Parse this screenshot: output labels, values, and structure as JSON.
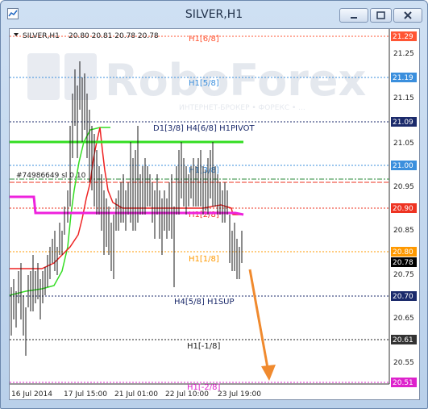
{
  "window": {
    "title": "SILVER,H1",
    "buttons": [
      "minimize",
      "maximize",
      "close"
    ]
  },
  "chart": {
    "symbol_label": "SILVER,H1",
    "ohlc": "20.80 20.81 20.78 20.78",
    "watermark": "RoboForex",
    "watermark_sub": "ИНТЕРНЕТ-БРОКЕР • ФОРЕКС • ...",
    "order_label": "#74986649 sl 0.10",
    "y_labels": [
      "21.29",
      "21.19",
      "21.09",
      "21.00",
      "20.90",
      "20.80",
      "20.78",
      "20.70",
      "20.61",
      "20.51",
      "21.25",
      "21.15",
      "21.05",
      "20.95",
      "20.85",
      "20.75",
      "20.65",
      "20.55"
    ],
    "x_labels": [
      "16 Jul 2014",
      "17 Jul 15:00",
      "21 Jul 01:00",
      "22 Jul 10:00",
      "23 Jul 19:00"
    ],
    "levels": [
      {
        "label": "H1[6/8]",
        "value": "21.29",
        "color": "#ff5533"
      },
      {
        "label": "H1[5/8]",
        "value": "21.19",
        "color": "#3b8fdd"
      },
      {
        "label": "D1[3/8] H4[6/8] H1PIVOT",
        "value": "21.09",
        "color": "#1b2a6b"
      },
      {
        "label": "H1[3/8]",
        "value": "21.00",
        "color": "#3b8fdd"
      },
      {
        "label": "H1[2/8]",
        "value": "20.90",
        "color": "#ee3322"
      },
      {
        "label": "H1[1/8]",
        "value": "20.80",
        "color": "#ff9900"
      },
      {
        "label": "H4[5/8] H1SUP",
        "value": "20.70",
        "color": "#1b2a6b"
      },
      {
        "label": "H1[-1/8]",
        "value": "20.61",
        "color": "#222222"
      },
      {
        "label": "H1[-2/8]",
        "value": "20.51",
        "color": "#dd22cc"
      }
    ],
    "current_price": "20.78",
    "forecast_arrow_color": "#f08a2e"
  }
}
